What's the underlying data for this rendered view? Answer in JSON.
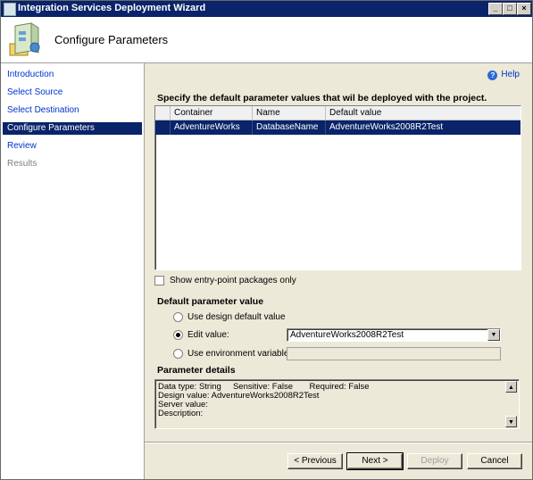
{
  "window": {
    "title": "Integration Services Deployment Wizard",
    "minimize_label": "_",
    "maximize_label": "□",
    "close_label": "×"
  },
  "header": {
    "title": "Configure Parameters"
  },
  "sidebar": {
    "items": [
      {
        "label": "Introduction",
        "state": "link"
      },
      {
        "label": "Select Source",
        "state": "link"
      },
      {
        "label": "Select Destination",
        "state": "link"
      },
      {
        "label": "Configure Parameters",
        "state": "active"
      },
      {
        "label": "Review",
        "state": "link"
      },
      {
        "label": "Results",
        "state": "disabled"
      }
    ]
  },
  "main": {
    "help_label": "Help",
    "help_icon": "?",
    "instruction": "Specify the default parameter values that wil be deployed with the project.",
    "grid": {
      "columns": [
        "Container",
        "Name",
        "Default value"
      ],
      "rows": [
        {
          "container": "AdventureWorks",
          "name": "DatabaseName",
          "default_value": "AdventureWorks2008R2Test"
        }
      ],
      "scroll_left": "◀",
      "scroll_right": "▶"
    },
    "show_entry_point": {
      "label": "Show entry-point packages only",
      "checked": false
    },
    "default_parameter_value": {
      "heading": "Default parameter value",
      "options": [
        {
          "label": "Use design default value",
          "checked": false
        },
        {
          "label": "Edit value:",
          "checked": true
        },
        {
          "label": "Use environment variable:",
          "checked": false
        }
      ],
      "edit_value": "AdventureWorks2008R2Test",
      "dropdown_arrow": "▼",
      "environment_variable": ""
    },
    "parameter_details": {
      "heading": "Parameter details",
      "line1": "Data type: String     Sensitive: False       Required: False",
      "line2": "Design value: AdventureWorks2008R2Test",
      "line3": "Server value:",
      "line4": "Description:",
      "scroll_up": "▲",
      "scroll_down": "▼"
    }
  },
  "buttons": {
    "previous": "< Previous",
    "next": "Next >",
    "deploy": "Deploy",
    "cancel": "Cancel"
  },
  "colors": {
    "selection": "#0a246a",
    "link": "#0033cc",
    "panel": "#ece9d8"
  }
}
